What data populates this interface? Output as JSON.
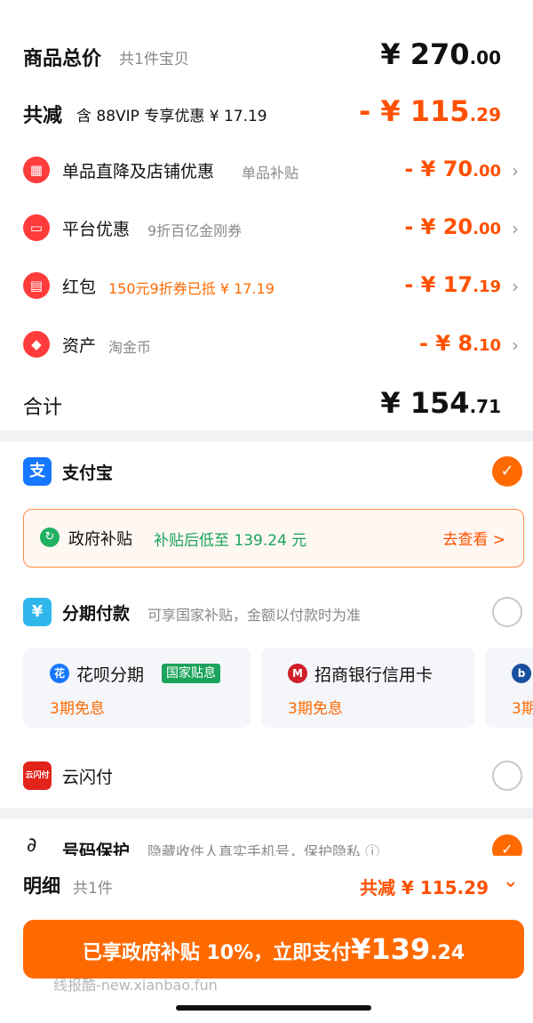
{
  "summary": {
    "total_label": "商品总价",
    "total_count": "共1件宝贝",
    "total_price_int": "¥ 270",
    "total_price_dec": ".00",
    "reduce_label": "共减",
    "reduce_desc": "含 88VIP 专享优惠 ¥ 17.19",
    "reduce_int": "- ¥ 115",
    "reduce_dec": ".29",
    "discounts": [
      {
        "icon": "store-icon",
        "label": "单品直降及店铺优惠",
        "desc": "单品补贴",
        "amount_int": "- ¥ 70",
        "amount_dec": ".00"
      },
      {
        "icon": "ticket-icon",
        "label": "平台优惠",
        "desc": "9折百亿金刚券",
        "amount_int": "- ¥ 20",
        "amount_dec": ".00"
      },
      {
        "icon": "redpacket-icon",
        "label": "红包",
        "desc": "150元9折券已抵 ¥ 17.19",
        "amount_int": "- ¥ 17",
        "amount_dec": ".19"
      },
      {
        "icon": "asset-tag-icon",
        "label": "资产",
        "desc": "淘金币",
        "amount_int": "- ¥ 8",
        "amount_dec": ".10"
      }
    ],
    "subtotal_label": "合计",
    "subtotal_int": "¥ 154",
    "subtotal_dec": ".71"
  },
  "payment": {
    "alipay_label": "支付宝",
    "alipay_icon_text": "支",
    "subsidy_title": "政府补贴",
    "subsidy_desc": "补贴后低至 139.24 元",
    "subsidy_link": "去查看 >",
    "installment_label": "分期付款",
    "installment_desc": "可享国家补贴，金额以付款时为准",
    "installment_icon_text": "¥",
    "installment_options": [
      {
        "name": "花呗分期",
        "tag": "国家贴息",
        "sub": "3期免息"
      },
      {
        "name": "招商银行信用卡",
        "tag": "",
        "sub": "3期免息"
      },
      {
        "name": "",
        "tag": "",
        "sub": "3期"
      }
    ],
    "unionpay_label": "云闪付",
    "unionpay_icon_text": "云闪付"
  },
  "protect": {
    "label": "号码保护",
    "desc": "隐藏收件人真实手机号，保护隐私 ⓘ"
  },
  "bottom": {
    "detail_title": "明细",
    "detail_sub": "共1件",
    "detail_save": "共减 ¥ 115.29",
    "pay_prefix": "已享政府补贴 10%，立即支付",
    "pay_int": "¥139",
    "pay_dec": ".24",
    "watermark": "线报酷-new.xianbao.fun"
  },
  "colors": {
    "accent": "#ff6a00",
    "price_orange": "#ff5000",
    "green": "#1aa35a",
    "alipay_blue": "#1677ff"
  }
}
